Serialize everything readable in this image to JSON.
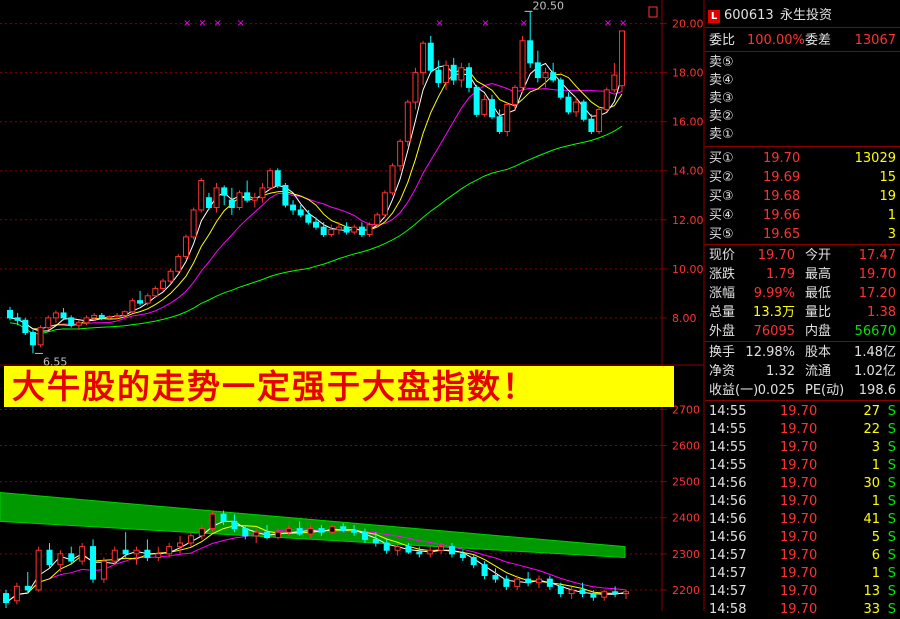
{
  "stock": {
    "code": "600613",
    "name": "永生投资",
    "badge": "L"
  },
  "commission": {
    "ratio_label": "委比",
    "ratio": "100.00%",
    "diff_label": "委差",
    "diff": "13067"
  },
  "sell_labels": [
    "卖⑤",
    "卖④",
    "卖③",
    "卖②",
    "卖①"
  ],
  "buy": [
    {
      "label": "买①",
      "price": "19.70",
      "vol": "13029"
    },
    {
      "label": "买②",
      "price": "19.69",
      "vol": "15"
    },
    {
      "label": "买③",
      "price": "19.68",
      "vol": "19"
    },
    {
      "label": "买④",
      "price": "19.66",
      "vol": "1"
    },
    {
      "label": "买⑤",
      "price": "19.65",
      "vol": "3"
    }
  ],
  "quote": [
    {
      "l1": "现价",
      "v1": "19.70",
      "l2": "今开",
      "v2": "17.47"
    },
    {
      "l1": "涨跌",
      "v1": "1.79",
      "l2": "最高",
      "v2": "19.70"
    },
    {
      "l1": "涨幅",
      "v1": "9.99%",
      "l2": "最低",
      "v2": "17.20"
    },
    {
      "l1": "总量",
      "v1": "13.3万",
      "l2": "量比",
      "v2": "1.38"
    },
    {
      "l1": "外盘",
      "v1": "76095",
      "l2": "内盘",
      "v2": "56670"
    }
  ],
  "fundamentals": [
    {
      "l1": "换手",
      "v1": "12.98%",
      "l2": "股本",
      "v2": "1.48亿"
    },
    {
      "l1": "净资",
      "v1": "1.32",
      "l2": "流通",
      "v2": "1.02亿"
    },
    {
      "l1": "收益(一)",
      "v1": "0.025",
      "l2": "PE(动)",
      "v2": "198.6"
    }
  ],
  "ticks": [
    {
      "time": "14:55",
      "price": "19.70",
      "vol": "27",
      "side": "S"
    },
    {
      "time": "14:55",
      "price": "19.70",
      "vol": "22",
      "side": "S"
    },
    {
      "time": "14:55",
      "price": "19.70",
      "vol": "3",
      "side": "S"
    },
    {
      "time": "14:55",
      "price": "19.70",
      "vol": "1",
      "side": "S"
    },
    {
      "time": "14:56",
      "price": "19.70",
      "vol": "30",
      "side": "S"
    },
    {
      "time": "14:56",
      "price": "19.70",
      "vol": "1",
      "side": "S"
    },
    {
      "time": "14:56",
      "price": "19.70",
      "vol": "41",
      "side": "S"
    },
    {
      "time": "14:56",
      "price": "19.70",
      "vol": "5",
      "side": "S"
    },
    {
      "time": "14:57",
      "price": "19.70",
      "vol": "6",
      "side": "S"
    },
    {
      "time": "14:57",
      "price": "19.70",
      "vol": "1",
      "side": "S"
    },
    {
      "time": "14:57",
      "price": "19.70",
      "vol": "13",
      "side": "S"
    },
    {
      "time": "14:58",
      "price": "19.70",
      "vol": "33",
      "side": "S"
    }
  ],
  "banner": "大牛股的走势一定强于大盘指数！",
  "colors": {
    "up": "#ff3232",
    "down": "#00ffff",
    "ma5": "#ffffff",
    "ma10": "#ffff00",
    "ma20": "#ff00ff",
    "ma60": "#00ff00",
    "grid": "#8b0000",
    "axis_text": "#ff3232"
  },
  "chart_data": [
    {
      "type": "candlestick",
      "title": "",
      "ylim": [
        6.2,
        20.8
      ],
      "y_ticks": [
        8.0,
        10.0,
        12.0,
        14.0,
        16.0,
        18.0,
        20.0
      ],
      "y_tick_labels": [
        "8.00",
        "10.00",
        "12.00",
        "14.00",
        "16.00",
        "18.00",
        "20.00"
      ],
      "annotations": [
        {
          "text": "20.50",
          "bar": 67,
          "value": 20.5
        },
        {
          "text": "6.55",
          "bar": 3,
          "value": 6.55
        }
      ],
      "markers": {
        "symbol": "×",
        "bars": [
          23,
          25,
          27,
          30,
          56,
          62,
          67,
          78,
          80
        ]
      },
      "candles": [
        [
          8.3,
          8.45,
          7.9,
          8.0
        ],
        [
          8.0,
          8.2,
          7.7,
          7.9
        ],
        [
          7.9,
          8.0,
          7.3,
          7.4
        ],
        [
          7.4,
          7.5,
          6.55,
          6.9
        ],
        [
          6.9,
          7.7,
          6.8,
          7.6
        ],
        [
          7.6,
          8.1,
          7.5,
          8.0
        ],
        [
          8.0,
          8.3,
          7.8,
          8.2
        ],
        [
          8.2,
          8.4,
          7.9,
          8.0
        ],
        [
          8.0,
          8.1,
          7.6,
          7.7
        ],
        [
          7.7,
          7.9,
          7.5,
          7.8
        ],
        [
          7.8,
          8.1,
          7.7,
          8.0
        ],
        [
          8.0,
          8.2,
          7.9,
          8.1
        ],
        [
          8.1,
          8.2,
          7.9,
          8.0
        ],
        [
          8.0,
          8.1,
          7.9,
          8.05
        ],
        [
          8.05,
          8.2,
          7.95,
          8.1
        ],
        [
          8.1,
          8.3,
          8.0,
          8.25
        ],
        [
          8.25,
          8.8,
          8.2,
          8.7
        ],
        [
          8.7,
          9.1,
          8.5,
          8.6
        ],
        [
          8.6,
          9.0,
          8.5,
          8.9
        ],
        [
          8.9,
          9.3,
          8.8,
          9.2
        ],
        [
          9.2,
          9.6,
          9.1,
          9.5
        ],
        [
          9.5,
          10.0,
          9.4,
          9.9
        ],
        [
          9.9,
          10.6,
          9.8,
          10.5
        ],
        [
          10.5,
          11.4,
          10.4,
          11.3
        ],
        [
          11.3,
          12.5,
          11.2,
          12.4
        ],
        [
          12.4,
          13.7,
          12.3,
          13.6
        ],
        [
          12.9,
          13.1,
          12.4,
          12.5
        ],
        [
          12.5,
          13.5,
          12.3,
          13.3
        ],
        [
          13.3,
          13.4,
          12.6,
          13.0
        ],
        [
          12.8,
          13.3,
          12.2,
          12.5
        ],
        [
          12.5,
          13.2,
          12.4,
          13.1
        ],
        [
          13.1,
          13.6,
          12.7,
          12.8
        ],
        [
          12.8,
          13.1,
          12.5,
          12.9
        ],
        [
          12.9,
          13.5,
          12.7,
          13.3
        ],
        [
          13.3,
          14.1,
          13.2,
          14.0
        ],
        [
          14.0,
          14.1,
          13.3,
          13.4
        ],
        [
          13.4,
          13.5,
          12.5,
          12.6
        ],
        [
          12.6,
          12.8,
          12.2,
          12.4
        ],
        [
          12.4,
          12.6,
          12.1,
          12.2
        ],
        [
          12.2,
          12.4,
          11.8,
          11.9
        ],
        [
          11.9,
          12.1,
          11.6,
          11.7
        ],
        [
          11.7,
          11.9,
          11.3,
          11.4
        ],
        [
          11.4,
          11.8,
          11.3,
          11.6
        ],
        [
          11.6,
          11.9,
          11.4,
          11.7
        ],
        [
          11.7,
          11.9,
          11.4,
          11.5
        ],
        [
          11.5,
          11.8,
          11.4,
          11.7
        ],
        [
          11.7,
          11.9,
          11.3,
          11.4
        ],
        [
          11.4,
          11.9,
          11.3,
          11.8
        ],
        [
          11.8,
          12.3,
          11.7,
          12.2
        ],
        [
          12.2,
          13.2,
          12.1,
          13.1
        ],
        [
          13.1,
          14.3,
          13.0,
          14.2
        ],
        [
          14.2,
          15.3,
          14.0,
          15.2
        ],
        [
          15.2,
          16.9,
          15.0,
          16.8
        ],
        [
          16.8,
          18.2,
          16.5,
          18.0
        ],
        [
          18.0,
          19.3,
          17.5,
          19.2
        ],
        [
          19.2,
          19.5,
          18.0,
          18.1
        ],
        [
          18.1,
          18.5,
          17.4,
          17.6
        ],
        [
          17.6,
          18.5,
          17.3,
          18.3
        ],
        [
          18.3,
          18.6,
          17.5,
          17.7
        ],
        [
          17.7,
          18.4,
          17.4,
          18.2
        ],
        [
          18.2,
          18.4,
          17.2,
          17.4
        ],
        [
          17.4,
          17.5,
          16.2,
          16.3
        ],
        [
          16.3,
          17.1,
          16.2,
          16.9
        ],
        [
          16.9,
          17.1,
          16.1,
          16.2
        ],
        [
          16.2,
          16.5,
          15.5,
          15.6
        ],
        [
          15.6,
          16.8,
          15.4,
          16.7
        ],
        [
          16.7,
          17.5,
          16.5,
          17.4
        ],
        [
          17.4,
          19.5,
          17.2,
          19.3
        ],
        [
          19.3,
          20.5,
          18.2,
          18.4
        ],
        [
          18.4,
          18.9,
          17.6,
          17.8
        ],
        [
          17.8,
          18.2,
          17.4,
          18.0
        ],
        [
          18.0,
          18.4,
          17.6,
          17.7
        ],
        [
          17.7,
          17.8,
          16.9,
          17.0
        ],
        [
          17.0,
          17.2,
          16.3,
          16.4
        ],
        [
          16.4,
          17.0,
          16.2,
          16.8
        ],
        [
          16.8,
          16.9,
          16.0,
          16.1
        ],
        [
          16.1,
          16.3,
          15.5,
          15.6
        ],
        [
          15.6,
          16.6,
          15.5,
          16.5
        ],
        [
          16.5,
          17.4,
          16.4,
          17.3
        ],
        [
          17.3,
          18.4,
          17.2,
          17.9
        ],
        [
          17.47,
          19.7,
          17.2,
          19.7
        ]
      ]
    },
    {
      "type": "candlestick",
      "title": "",
      "ylim": [
        2150,
        2740
      ],
      "y_ticks": [
        2200,
        2300,
        2400,
        2500,
        2600,
        2700
      ],
      "y_tick_labels": [
        "2200",
        "2300",
        "2400",
        "2500",
        "2600",
        "2700"
      ],
      "band": {
        "upper_start": 2470,
        "upper_end": 2320,
        "lower_start": 2390,
        "lower_end": 2290
      },
      "candles": [
        [
          2190,
          2200,
          2150,
          2165
        ],
        [
          2170,
          2220,
          2160,
          2210
        ],
        [
          2210,
          2250,
          2190,
          2200
        ],
        [
          2200,
          2320,
          2195,
          2310
        ],
        [
          2310,
          2330,
          2260,
          2270
        ],
        [
          2270,
          2310,
          2250,
          2300
        ],
        [
          2300,
          2320,
          2270,
          2280
        ],
        [
          2280,
          2330,
          2270,
          2320
        ],
        [
          2320,
          2340,
          2220,
          2230
        ],
        [
          2230,
          2290,
          2220,
          2280
        ],
        [
          2280,
          2320,
          2270,
          2310
        ],
        [
          2310,
          2360,
          2290,
          2300
        ],
        [
          2300,
          2320,
          2270,
          2310
        ],
        [
          2310,
          2340,
          2280,
          2290
        ],
        [
          2290,
          2320,
          2280,
          2300
        ],
        [
          2300,
          2330,
          2290,
          2320
        ],
        [
          2320,
          2350,
          2300,
          2330
        ],
        [
          2330,
          2360,
          2320,
          2350
        ],
        [
          2350,
          2380,
          2340,
          2370
        ],
        [
          2370,
          2420,
          2360,
          2410
        ],
        [
          2410,
          2420,
          2380,
          2390
        ],
        [
          2390,
          2410,
          2360,
          2370
        ],
        [
          2370,
          2380,
          2340,
          2350
        ],
        [
          2350,
          2370,
          2330,
          2360
        ],
        [
          2360,
          2380,
          2340,
          2345
        ],
        [
          2345,
          2370,
          2340,
          2360
        ],
        [
          2360,
          2380,
          2350,
          2370
        ],
        [
          2370,
          2390,
          2350,
          2355
        ],
        [
          2355,
          2380,
          2345,
          2370
        ],
        [
          2370,
          2380,
          2350,
          2360
        ],
        [
          2360,
          2380,
          2355,
          2375
        ],
        [
          2375,
          2385,
          2360,
          2365
        ],
        [
          2365,
          2380,
          2350,
          2360
        ],
        [
          2360,
          2370,
          2330,
          2340
        ],
        [
          2340,
          2360,
          2320,
          2330
        ],
        [
          2330,
          2340,
          2300,
          2310
        ],
        [
          2310,
          2330,
          2295,
          2320
        ],
        [
          2320,
          2330,
          2300,
          2305
        ],
        [
          2305,
          2320,
          2290,
          2300
        ],
        [
          2300,
          2320,
          2290,
          2310
        ],
        [
          2310,
          2330,
          2300,
          2320
        ],
        [
          2320,
          2330,
          2290,
          2300
        ],
        [
          2300,
          2310,
          2280,
          2290
        ],
        [
          2290,
          2300,
          2260,
          2270
        ],
        [
          2270,
          2280,
          2230,
          2240
        ],
        [
          2240,
          2260,
          2220,
          2230
        ],
        [
          2230,
          2240,
          2200,
          2210
        ],
        [
          2210,
          2240,
          2200,
          2230
        ],
        [
          2230,
          2250,
          2210,
          2220
        ],
        [
          2220,
          2240,
          2205,
          2230
        ],
        [
          2230,
          2240,
          2200,
          2210
        ],
        [
          2210,
          2220,
          2180,
          2190
        ],
        [
          2190,
          2210,
          2175,
          2200
        ],
        [
          2200,
          2220,
          2180,
          2190
        ],
        [
          2190,
          2200,
          2170,
          2180
        ],
        [
          2180,
          2200,
          2170,
          2195
        ],
        [
          2195,
          2210,
          2180,
          2190
        ],
        [
          2190,
          2200,
          2175,
          2195
        ]
      ]
    }
  ]
}
